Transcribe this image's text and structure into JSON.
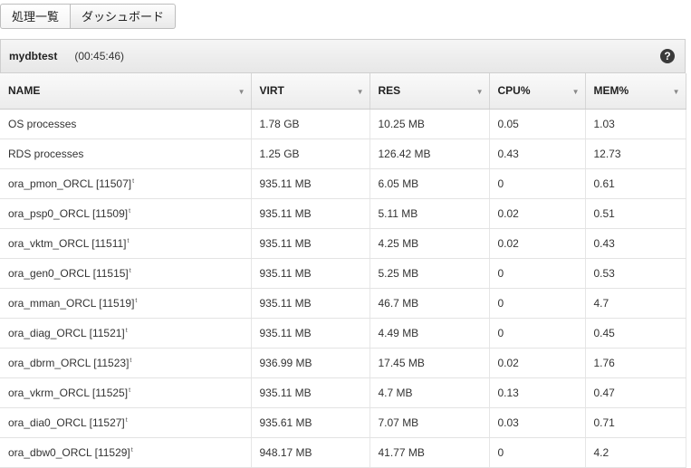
{
  "tabs": [
    "処理一覧",
    "ダッシュボード"
  ],
  "instance": {
    "name": "mydbtest",
    "time": "(00:45:46)"
  },
  "help_glyph": "?",
  "columns": [
    "NAME",
    "VIRT",
    "RES",
    "CPU%",
    "MEM%"
  ],
  "rows": [
    {
      "name": "OS processes",
      "mark": "",
      "virt": "1.78 GB",
      "res": "10.25 MB",
      "cpu": "0.05",
      "mem": "1.03"
    },
    {
      "name": "RDS processes",
      "mark": "",
      "virt": "1.25 GB",
      "res": "126.42 MB",
      "cpu": "0.43",
      "mem": "12.73"
    },
    {
      "name": "ora_pmon_ORCL [11507]",
      "mark": "t",
      "virt": "935.11 MB",
      "res": "6.05 MB",
      "cpu": "0",
      "mem": "0.61"
    },
    {
      "name": "ora_psp0_ORCL [11509]",
      "mark": "t",
      "virt": "935.11 MB",
      "res": "5.11 MB",
      "cpu": "0.02",
      "mem": "0.51"
    },
    {
      "name": "ora_vktm_ORCL [11511]",
      "mark": "t",
      "virt": "935.11 MB",
      "res": "4.25 MB",
      "cpu": "0.02",
      "mem": "0.43"
    },
    {
      "name": "ora_gen0_ORCL [11515]",
      "mark": "t",
      "virt": "935.11 MB",
      "res": "5.25 MB",
      "cpu": "0",
      "mem": "0.53"
    },
    {
      "name": "ora_mman_ORCL [11519]",
      "mark": "t",
      "virt": "935.11 MB",
      "res": "46.7 MB",
      "cpu": "0",
      "mem": "4.7"
    },
    {
      "name": "ora_diag_ORCL [11521]",
      "mark": "t",
      "virt": "935.11 MB",
      "res": "4.49 MB",
      "cpu": "0",
      "mem": "0.45"
    },
    {
      "name": "ora_dbrm_ORCL [11523]",
      "mark": "t",
      "virt": "936.99 MB",
      "res": "17.45 MB",
      "cpu": "0.02",
      "mem": "1.76"
    },
    {
      "name": "ora_vkrm_ORCL [11525]",
      "mark": "t",
      "virt": "935.11 MB",
      "res": "4.7 MB",
      "cpu": "0.13",
      "mem": "0.47"
    },
    {
      "name": "ora_dia0_ORCL [11527]",
      "mark": "t",
      "virt": "935.61 MB",
      "res": "7.07 MB",
      "cpu": "0.03",
      "mem": "0.71"
    },
    {
      "name": "ora_dbw0_ORCL [11529]",
      "mark": "t",
      "virt": "948.17 MB",
      "res": "41.77 MB",
      "cpu": "0",
      "mem": "4.2"
    }
  ]
}
